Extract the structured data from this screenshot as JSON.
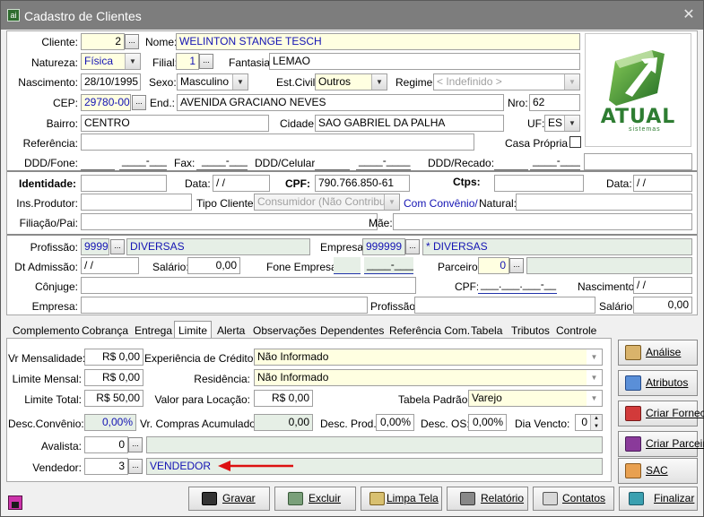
{
  "window": {
    "title": "Cadastro de Clientes",
    "close_glyph": "✕",
    "app_icon": "ai"
  },
  "logo": {
    "brand": "ATUAL",
    "tagline": "sistemas",
    "icon": "atual-logo-icon",
    "brand_color": "#2e7d32"
  },
  "labels": {
    "cliente": "Cliente:",
    "nome": "Nome:",
    "natureza": "Natureza:",
    "filial": "Filial:",
    "fantasia": "Fantasia:",
    "nascimento": "Nascimento:",
    "sexo": "Sexo:",
    "estcivil": "Est.Civil:",
    "regime": "Regime:",
    "cep": "CEP:",
    "end": "End.:",
    "nro": "Nro:",
    "bairro": "Bairro:",
    "cidade": "Cidade:",
    "uf": "UF:",
    "referencia": "Referência:",
    "casapropria": "Casa Própria",
    "dddfone": "DDD/Fone:",
    "fax": "Fax:",
    "dddcelular": "DDD/Celular:",
    "dddrecado": "DDD/Recado:",
    "identidade": "Identidade:",
    "data": "Data:",
    "cpf": "CPF:",
    "ctps": "Ctps:",
    "data2": "Data:",
    "insprodutor": "Ins.Produtor:",
    "tipocliente": "Tipo Cliente:",
    "comconvenio": "Com Convênio/",
    "natural": "Natural:",
    "filiacaopai": "Filiação/Pai:",
    "mae": "Mãe:",
    "profissao": "Profissão:",
    "empresa": "Empresa:",
    "dtadmissao": "Dt Admissão:",
    "salario": "Salário:",
    "foneempresa": "Fone Empresa:",
    "parceiro": "Parceiro:",
    "conjuge": "Cônjuge:",
    "cpf2": "CPF:",
    "nascimento2": "Nascimento:",
    "empresa2": "Empresa:",
    "profissao2": "Profissão:",
    "salario2": "Salário:"
  },
  "values": {
    "cliente": "2",
    "nome": "WELINTON STANGE TESCH",
    "natureza": "Física",
    "filial": "1",
    "fantasia": "LEMAO",
    "nascimento": "28/10/1995",
    "sexo": "Masculino",
    "estcivil": "Outros",
    "regime": "< Indefinido >",
    "cep": "29780-000",
    "end": "AVENIDA GRACIANO NEVES",
    "nro": "62",
    "bairro": "CENTRO",
    "cidade": "SAO GABRIEL DA PALHA",
    "uf": "ES",
    "referencia": "",
    "fone_ddd": "",
    "fone_num": "____-____",
    "fax_ddd": "",
    "fax_num": "____-____",
    "cel_ddd": "",
    "cel_num": "____-____",
    "rec_ddd": "",
    "rec_num": "____-____",
    "rec_extra": "",
    "identidade": "",
    "data_ident": " /  /",
    "cpf": "790.766.850-61",
    "ctps": "",
    "data_ctps": " /  /",
    "insprodutor": "",
    "tipocliente": "Consumidor (Não Contribuinte",
    "natural": "",
    "filiacaopai": "",
    "mae": "",
    "profissao_cod": "9999",
    "profissao": "DIVERSAS",
    "empresa_cod": "999999",
    "empresa": "* DIVERSAS",
    "dtadmissao": " /  /",
    "salario": "0,00",
    "foneempresa_ddd": "",
    "foneempresa_num": "____-____",
    "parceiro_cod": "0",
    "parceiro_nome": "",
    "conjuge": "",
    "cpf_conjuge": "___.___.___-__",
    "nascimento_conjuge": " /  /",
    "empresa_conjuge": "",
    "profissao_conjuge": "",
    "salario_conjuge": "0,00"
  },
  "tabs": [
    "Complemento",
    "Cobrança",
    "Entrega",
    "Limite",
    "Alerta",
    "Observações",
    "Dependentes",
    "Referência Com.",
    "Tabela",
    "Tributos",
    "Controle"
  ],
  "active_tab": "Limite",
  "limite": {
    "labels": {
      "vrmensalidade": "Vr Mensalidade:",
      "limitemensal": "Limite Mensal:",
      "limitetotal": "Limite Total:",
      "descconvenio": "Desc.Convênio:",
      "avalista": "Avalista:",
      "vendedor": "Vendedor:",
      "experiencia": "Experiência de Crédito:",
      "residencia": "Residência:",
      "valorlocacao": "Valor para Locação:",
      "vrcompras": "Vr. Compras Acumulado:",
      "descprod": "Desc. Prod.:",
      "descos": "Desc. OS:",
      "diavencto": "Dia Vencto:",
      "tabelapadrao": "Tabela Padrão:"
    },
    "values": {
      "vrmensalidade": "R$ 0,00",
      "limitemensal": "R$ 0,00",
      "limitetotal": "R$ 50,00",
      "descconvenio": "0,00%",
      "avalista_cod": "0",
      "avalista_nome": "",
      "vendedor_cod": "3",
      "vendedor_nome": "VENDEDOR",
      "experiencia": "Não Informado",
      "residencia": "Não Informado",
      "valorlocacao": "R$ 0,00",
      "vrcompras": "0,00",
      "descprod": "0,00%",
      "descos": "0,00%",
      "diavencto": "0",
      "tabelapadrao": "Varejo"
    }
  },
  "side_buttons": [
    "Análise",
    "Atributos",
    "Criar Fornec.",
    "Criar Parceiro",
    "SAC"
  ],
  "bottom_buttons": [
    "Gravar",
    "Excluir",
    "Limpa Tela",
    "Relatório",
    "Contatos",
    "Finalizar"
  ],
  "glyphs": {
    "lookup": "...",
    "dropdown": "▼",
    "spin_up": "▲",
    "spin_down": "▼"
  },
  "colors": {
    "readonly_yellow": "#ffffe1",
    "readonly_green": "#e6efe6",
    "lookup_blue": "#1414b4",
    "arrow_red": "#dd1111"
  }
}
